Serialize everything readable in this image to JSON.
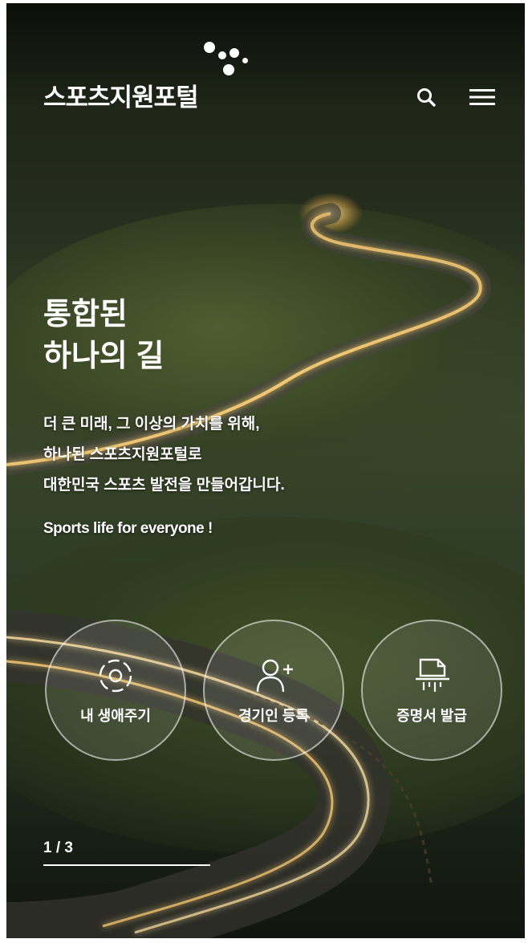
{
  "header": {
    "logo_text": "스포츠지원포털",
    "search_icon": "search-icon",
    "menu_icon": "hamburger-menu-icon"
  },
  "hero": {
    "title_lines": [
      "통합된",
      "하나의 길"
    ],
    "description_lines": [
      "더 큰 미래, 그 이상의 가치를 위해,",
      "하나된 스포츠지원포털로",
      "대한민국 스포츠 발전을 만들어갑니다."
    ],
    "tagline": "Sports life for everyone !"
  },
  "quick_links": [
    {
      "label": "내 생애주기",
      "icon": "lifecycle-icon"
    },
    {
      "label": "경기인 등록",
      "icon": "add-user-icon"
    },
    {
      "label": "증명서 발급",
      "icon": "certificate-print-icon"
    }
  ],
  "slider": {
    "pager": "1 / 3",
    "progress": 1.0
  },
  "colors": {
    "text": "#ffffff",
    "road_light": "#ffd27a"
  }
}
